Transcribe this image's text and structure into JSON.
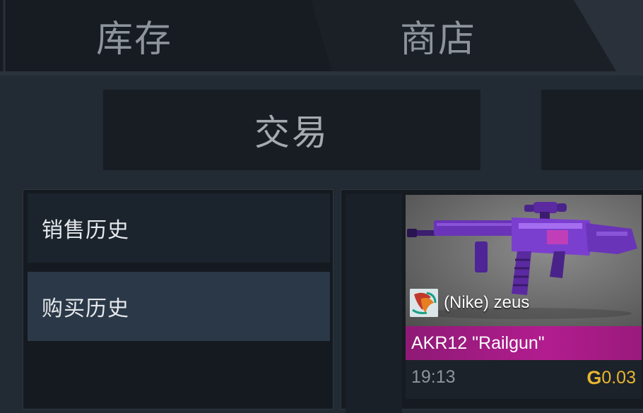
{
  "nav": {
    "tabs": [
      {
        "label": "库存"
      },
      {
        "label": "商店"
      }
    ]
  },
  "subtabs": [
    {
      "label": "交易"
    },
    {
      "label": ""
    }
  ],
  "history": {
    "items": [
      {
        "label": "销售历史"
      },
      {
        "label": "购买历史"
      }
    ]
  },
  "listing": {
    "owner": "(Nike) zeus",
    "item_name": "AKR12 \"Railgun\"",
    "time": "19:13",
    "price": "0.03",
    "currency_icon": "gold-coin-icon",
    "accent_color": "#b21c8f",
    "price_color": "#e8b431"
  }
}
